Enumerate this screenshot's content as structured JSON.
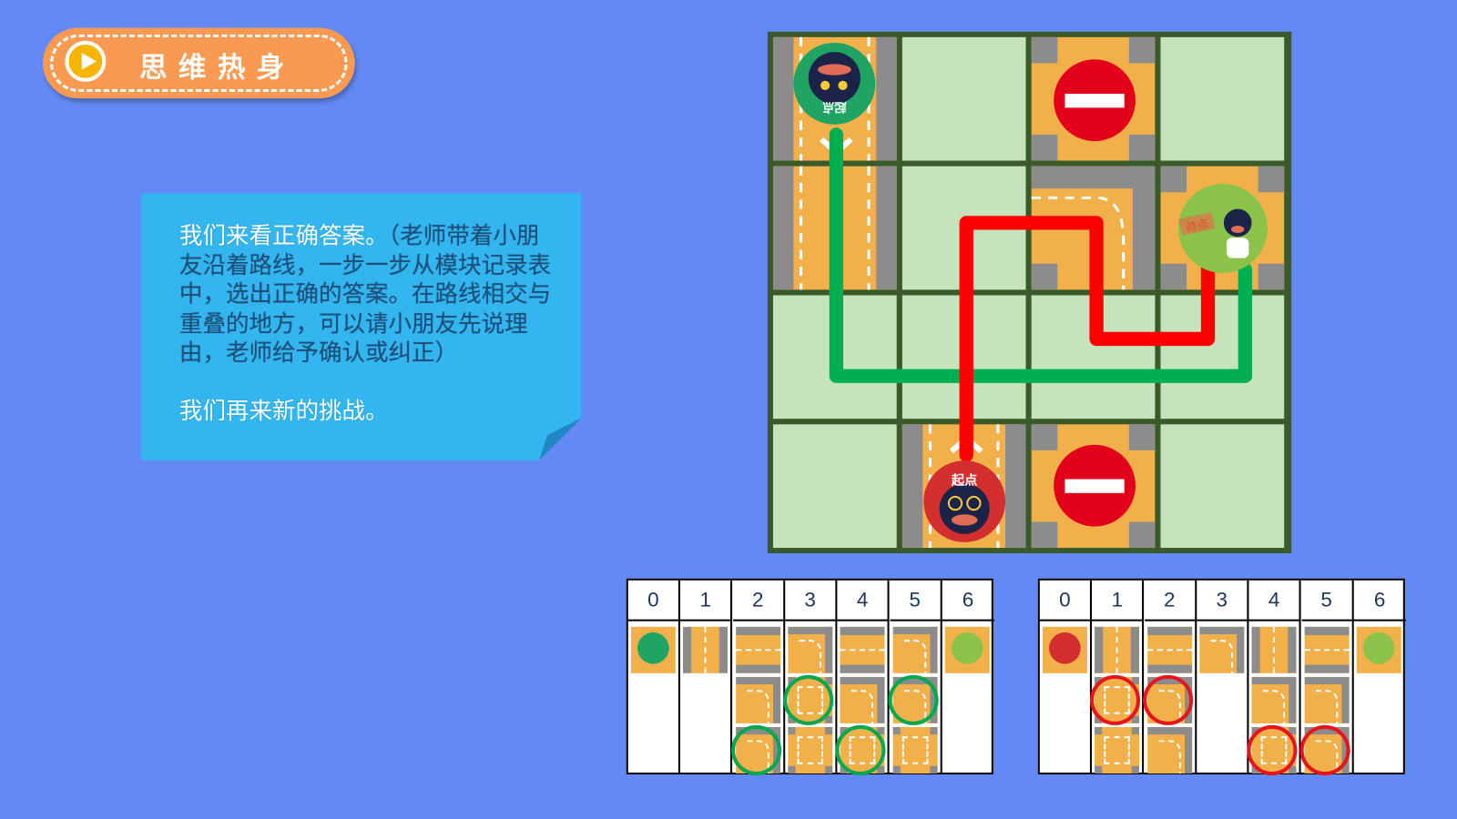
{
  "header": {
    "title": "思维热身",
    "icon": "play-icon"
  },
  "note": {
    "paragraph1_white": "我们来看正确答案。",
    "paragraph1_dark": "（老师带着小朋友沿着路线，一步一步从模块记录表中，选出正确的答案。在路线相交与重叠的地方，可以请小朋友先说理由，老师给予确认或纠正）",
    "paragraph2": "我们再来新的挑战。"
  },
  "board": {
    "start_green_label": "起点",
    "start_red_label": "起点",
    "finish_label": "终点",
    "colors": {
      "green_path": "#00b050",
      "red_path": "#ff0000",
      "grass": "#c5e4bc",
      "road": "#f2b04a",
      "border": "#3a5a2a"
    }
  },
  "tables": [
    {
      "name": "green",
      "ring_color": "#00a84f",
      "headers": [
        "0",
        "1",
        "2",
        "3",
        "4",
        "5",
        "6"
      ],
      "columns": [
        [
          {
            "t": "start-green"
          }
        ],
        [
          {
            "t": "vertical"
          }
        ],
        [
          {
            "t": "horizontal"
          },
          {
            "t": "curve"
          },
          {
            "t": "curve",
            "ring": true
          }
        ],
        [
          {
            "t": "curve"
          },
          {
            "t": "cross",
            "ring": true
          },
          {
            "t": "cross"
          }
        ],
        [
          {
            "t": "horizontal"
          },
          {
            "t": "curve"
          },
          {
            "t": "cross",
            "ring": true
          }
        ],
        [
          {
            "t": "curve"
          },
          {
            "t": "curve",
            "ring": true
          },
          {
            "t": "cross"
          }
        ],
        [
          {
            "t": "finish"
          }
        ]
      ]
    },
    {
      "name": "red",
      "ring_color": "#e8141c",
      "headers": [
        "0",
        "1",
        "2",
        "3",
        "4",
        "5",
        "6"
      ],
      "columns": [
        [
          {
            "t": "start-red"
          }
        ],
        [
          {
            "t": "vertical"
          },
          {
            "t": "cross",
            "ring": true
          },
          {
            "t": "cross"
          }
        ],
        [
          {
            "t": "horizontal"
          },
          {
            "t": "curve",
            "ring": true
          },
          {
            "t": "curve"
          }
        ],
        [
          {
            "t": "curve"
          }
        ],
        [
          {
            "t": "vertical"
          },
          {
            "t": "curve"
          },
          {
            "t": "cross",
            "ring": true
          }
        ],
        [
          {
            "t": "horizontal"
          },
          {
            "t": "curve"
          },
          {
            "t": "curve",
            "ring": true
          }
        ],
        [
          {
            "t": "finish"
          }
        ]
      ]
    }
  ]
}
